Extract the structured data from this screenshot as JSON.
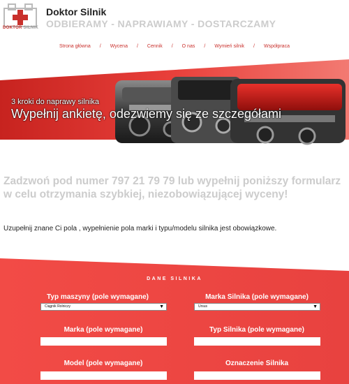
{
  "header": {
    "brand": "Doktor Silnik",
    "tagline": "ODBIERAMY - NAPRAWIAMY - DOSTARCZAMY",
    "logo": {
      "text_main": "DOKTOR",
      "text_sub": "SILNIK"
    }
  },
  "nav": {
    "items": [
      "Strona główna",
      "Wycena",
      "Cennik",
      "O nas",
      "Wymień silnik",
      "Współpraca"
    ],
    "separator": "/"
  },
  "hero": {
    "subtitle": "3 kroki do naprawy silnika",
    "title": "Wypełnij ankietę, odezwiemy się ze szczegółami"
  },
  "intro": {
    "headline": "Zadzwoń pod numer 797 21 79 79 lub wypełnij poniższy formularz w celu otrzymania szybkiej, niezobowiązującej wyceny!",
    "note": "Uzupełnij znane Ci pola , wypełnienie pola marki i typu/modelu silnika jest obowiązkowe."
  },
  "form": {
    "section_title": "DANE SILNIKA",
    "fields": {
      "typ_maszyny": {
        "label": "Typ maszyny (pole wymagane)",
        "value": "Ciągnik Rolniczy"
      },
      "marka_silnika": {
        "label": "Marka Silnika (pole wymagane)",
        "value": "Ursus"
      },
      "marka": {
        "label": "Marka (pole wymagane)",
        "value": ""
      },
      "typ_silnika": {
        "label": "Typ Silnika (pole wymagane)",
        "value": ""
      },
      "model": {
        "label": "Model (pole wymagane)",
        "value": ""
      },
      "oznaczenie": {
        "label": "Oznaczenie Silnika",
        "value": ""
      }
    }
  },
  "colors": {
    "brand_red": "#c9302c",
    "form_red": "#e8423f",
    "muted_text": "#cccccc"
  }
}
